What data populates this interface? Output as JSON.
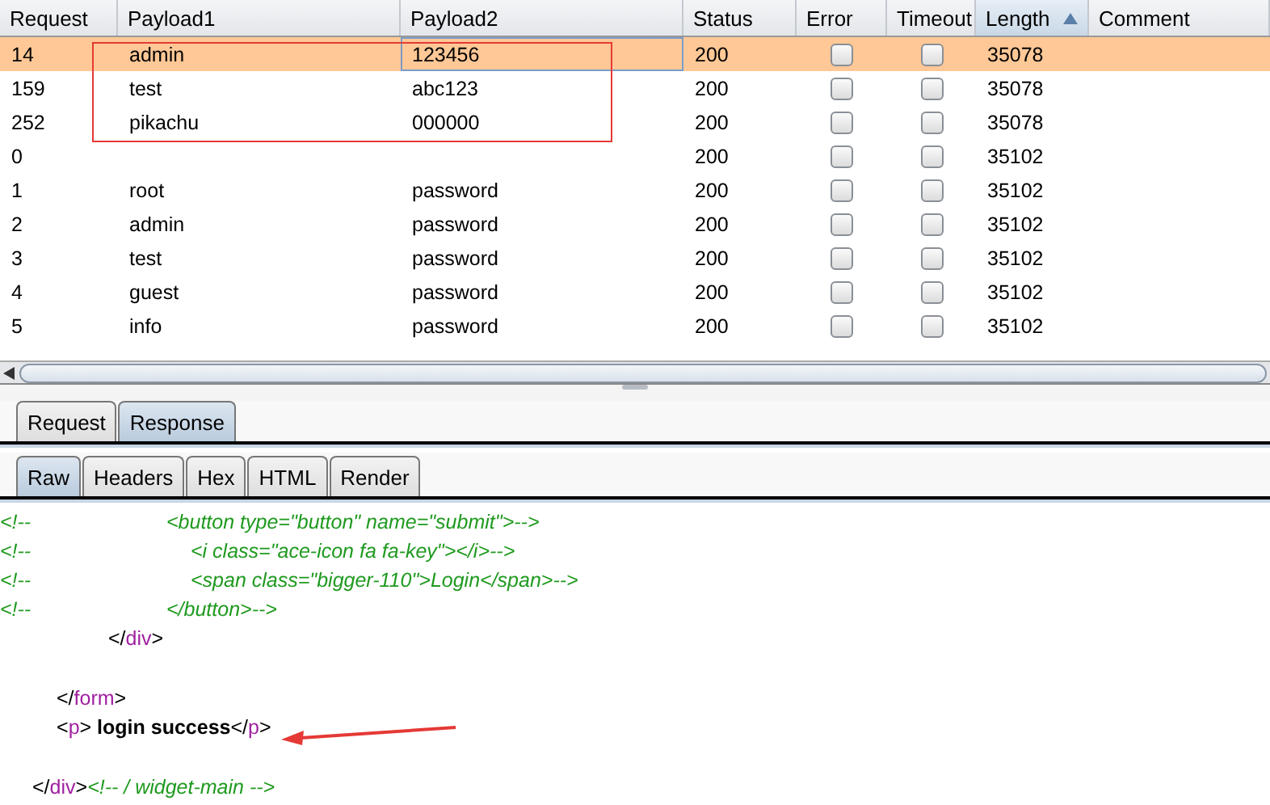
{
  "table": {
    "columns": [
      {
        "label": "Request",
        "sorted": false
      },
      {
        "label": "Payload1",
        "sorted": false
      },
      {
        "label": "Payload2",
        "sorted": false
      },
      {
        "label": "Status",
        "sorted": false
      },
      {
        "label": "Error",
        "sorted": false
      },
      {
        "label": "Timeout",
        "sorted": false
      },
      {
        "label": "Length",
        "sorted": true
      },
      {
        "label": "Comment",
        "sorted": false
      }
    ],
    "rows": [
      {
        "request": "14",
        "payload1": "admin",
        "payload2": "123456",
        "status": "200",
        "error": false,
        "timeout": false,
        "length": "35078",
        "selected": true
      },
      {
        "request": "159",
        "payload1": "test",
        "payload2": "abc123",
        "status": "200",
        "error": false,
        "timeout": false,
        "length": "35078",
        "selected": false
      },
      {
        "request": "252",
        "payload1": "pikachu",
        "payload2": "000000",
        "status": "200",
        "error": false,
        "timeout": false,
        "length": "35078",
        "selected": false
      },
      {
        "request": "0",
        "payload1": "",
        "payload2": "",
        "status": "200",
        "error": false,
        "timeout": false,
        "length": "35102",
        "selected": false
      },
      {
        "request": "1",
        "payload1": "root",
        "payload2": "password",
        "status": "200",
        "error": false,
        "timeout": false,
        "length": "35102",
        "selected": false
      },
      {
        "request": "2",
        "payload1": "admin",
        "payload2": "password",
        "status": "200",
        "error": false,
        "timeout": false,
        "length": "35102",
        "selected": false
      },
      {
        "request": "3",
        "payload1": "test",
        "payload2": "password",
        "status": "200",
        "error": false,
        "timeout": false,
        "length": "35102",
        "selected": false
      },
      {
        "request": "4",
        "payload1": "guest",
        "payload2": "password",
        "status": "200",
        "error": false,
        "timeout": false,
        "length": "35102",
        "selected": false
      },
      {
        "request": "5",
        "payload1": "info",
        "payload2": "password",
        "status": "200",
        "error": false,
        "timeout": false,
        "length": "35102",
        "selected": false
      }
    ]
  },
  "message_tabs": [
    {
      "label": "Request",
      "selected": false
    },
    {
      "label": "Response",
      "selected": true
    }
  ],
  "view_tabs": [
    {
      "label": "Raw",
      "selected": true
    },
    {
      "label": "Headers",
      "selected": false
    },
    {
      "label": "Hex",
      "selected": false
    },
    {
      "label": "HTML",
      "selected": false
    },
    {
      "label": "Render",
      "selected": false
    }
  ],
  "code_lines": [
    {
      "marker": "<!--",
      "segments": [
        {
          "kind": "comment",
          "text": "<button type=\"button\" name=\"submit\">-->"
        }
      ]
    },
    {
      "marker": "<!--",
      "segments": [
        {
          "kind": "comment",
          "text": "<i class=\"ace-icon fa fa-key\"></i>-->"
        }
      ]
    },
    {
      "marker": "<!--",
      "segments": [
        {
          "kind": "comment",
          "text": "<span class=\"bigger-110\">Login</span>-->"
        }
      ]
    },
    {
      "marker": "<!--",
      "segments": [
        {
          "kind": "comment",
          "text": "</button>-->"
        }
      ]
    },
    {
      "segments": [
        {
          "kind": "punct",
          "text": "</"
        },
        {
          "kind": "tag",
          "text": "div"
        },
        {
          "kind": "punct",
          "text": ">"
        }
      ]
    },
    {
      "blank": true
    },
    {
      "segments": [
        {
          "kind": "punct",
          "text": "</"
        },
        {
          "kind": "tag",
          "text": "form"
        },
        {
          "kind": "punct",
          "text": ">"
        }
      ]
    },
    {
      "segments": [
        {
          "kind": "punct",
          "text": "<"
        },
        {
          "kind": "tag",
          "text": "p"
        },
        {
          "kind": "punct",
          "text": "> "
        },
        {
          "kind": "bold",
          "text": "login success"
        },
        {
          "kind": "punct",
          "text": "</"
        },
        {
          "kind": "tag",
          "text": "p"
        },
        {
          "kind": "punct",
          "text": ">"
        }
      ]
    },
    {
      "blank": true
    },
    {
      "segments": [
        {
          "kind": "punct",
          "text": "</"
        },
        {
          "kind": "tag",
          "text": "div"
        },
        {
          "kind": "punct",
          "text": ">"
        },
        {
          "kind": "comment",
          "text": "<!-- / widget-main -->"
        }
      ]
    }
  ]
}
